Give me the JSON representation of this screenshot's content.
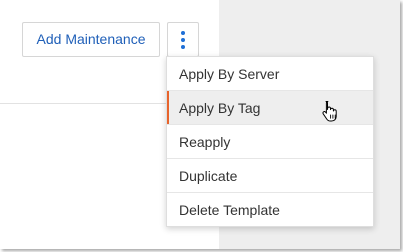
{
  "toolbar": {
    "add_label": "Add Maintenance"
  },
  "menu": {
    "items": [
      {
        "label": "Apply By Server"
      },
      {
        "label": "Apply By Tag"
      },
      {
        "label": "Reapply"
      },
      {
        "label": "Duplicate"
      },
      {
        "label": "Delete Template"
      }
    ],
    "hovered_index": 1
  },
  "colors": {
    "accent_blue": "#1f5fb8",
    "hover_indicator": "#e8642c",
    "side_panel": "#eeeeee"
  },
  "icons": {
    "more": "vertical-ellipsis-icon",
    "cursor": "hand-pointer-icon"
  }
}
